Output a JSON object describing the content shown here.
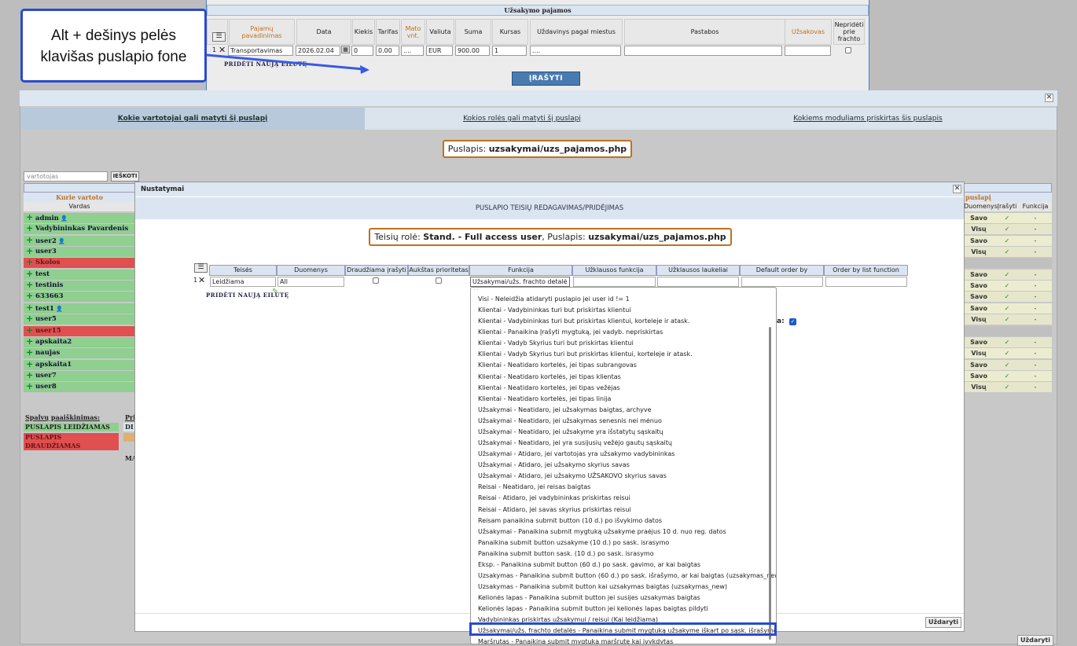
{
  "bg": {
    "title": "Užsakymo pajamos",
    "headers": [
      "Pajamų pavadinimas",
      "Data",
      "Kiekis",
      "Tarifas",
      "Mato vnt.",
      "Valiuta",
      "Suma",
      "Kursas",
      "Uždavinys pagal miestus",
      "Pastabos",
      "Užsakovas",
      "Nepridėti prie frachto"
    ],
    "row": {
      "num": "1",
      "name": "Transportavimas",
      "date": "2026.02.04",
      "qty": "0",
      "rate": "0.00",
      "unit": "....",
      "currency": "EUR",
      "sum": "900.00",
      "kursas": "1",
      "task": "....",
      "notes": "",
      "client": ""
    },
    "add_row": "PRIDĖTI NAUJĄ EILUTĘ",
    "save": "ĮRAŠYTI"
  },
  "callout": {
    "text": "Alt + dešinys pelės klavišas puslapio fone"
  },
  "dialog1": {
    "tabs": [
      "Kokie vartotojai gali matyti šį puslapį",
      "Kokios rolės gali matyti šį puslapį",
      "Kokiems moduliams priskirtas šis puslapis"
    ],
    "page_prefix": "Puslapis:",
    "page_name": "uzsakymai/uzs_pajamos.php",
    "search_placeholder": "vartotojas",
    "search_btn": "IEŠKOTI",
    "left_head_orange": "Kurie vartoto",
    "left_head": "Vardas",
    "users": [
      {
        "name": "admin",
        "cls": "g",
        "icon": true
      },
      {
        "name": "Vadybininkas Pavardenis",
        "cls": "g",
        "icon": false
      },
      {
        "name": "user2",
        "cls": "g",
        "icon": true
      },
      {
        "name": "user3",
        "cls": "g",
        "icon": false
      },
      {
        "name": "Skolos",
        "cls": "r",
        "icon": false
      },
      {
        "name": "test",
        "cls": "g",
        "icon": false
      },
      {
        "name": "testinis",
        "cls": "g",
        "icon": false
      },
      {
        "name": "633663",
        "cls": "g",
        "icon": false
      },
      {
        "name": "test1",
        "cls": "g",
        "icon": true
      },
      {
        "name": "user5",
        "cls": "g",
        "icon": false
      },
      {
        "name": "user15",
        "cls": "r",
        "icon": false
      },
      {
        "name": "apskaita2",
        "cls": "g",
        "icon": false
      },
      {
        "name": "naujas",
        "cls": "g",
        "icon": false
      },
      {
        "name": "apskaita1",
        "cls": "g",
        "icon": false
      },
      {
        "name": "user7",
        "cls": "g",
        "icon": false
      },
      {
        "name": "user8",
        "cls": "g",
        "icon": false
      }
    ],
    "right_head_orange": "puslapį",
    "right_heads": [
      "Duomenys",
      "Įrašyti",
      "Funkcija"
    ],
    "right_rows": [
      [
        "Savo",
        "✓",
        "-"
      ],
      [
        "Visų",
        "✓",
        "-"
      ],
      [
        "Savo",
        "✓",
        "-"
      ],
      [
        "Visų",
        "✓",
        "-"
      ],
      [
        "",
        "",
        ""
      ],
      [
        "Savo",
        "✓",
        "-"
      ],
      [
        "Savo",
        "✓",
        "-"
      ],
      [
        "Savo",
        "✓",
        "-"
      ],
      [
        "Savo",
        "✓",
        "-"
      ],
      [
        "Visų",
        "✓",
        "-"
      ],
      [
        "",
        "",
        ""
      ],
      [
        "Savo",
        "✓",
        "-"
      ],
      [
        "Visų",
        "✓",
        "-"
      ],
      [
        "Savo",
        "✓",
        "-"
      ],
      [
        "Savo",
        "✓",
        "-"
      ],
      [
        "Visų",
        "✓",
        "-"
      ]
    ],
    "legend_title": "Spalvų paaiškinimas:",
    "legend_allowed": "PUSLAPIS LEIDŽIAMAS",
    "legend_denied": "PUSLAPIS DRAUDŽIAMAS",
    "legend_pri": "Pri",
    "legend_di": "DI",
    "legend_ma": "MA",
    "close_btn": "Uždaryti"
  },
  "dialog2": {
    "title": "Nustatymai",
    "subtitle": "PUSLAPIO TEISIŲ REDAGAVIMAS/PRIDĖJIMAS",
    "role_prefix": "Teisių rolė:",
    "role_name": "Stand. - Full access user",
    "page_prefix": ", Puslapis:",
    "page_name": "uzsakymai/uzs_pajamos.php",
    "headers": [
      "Teisės",
      "Duomenys",
      "Draudžiama įrašyti",
      "Aukštas prioritetas",
      "Funkcija",
      "Užklausos funkcija",
      "Užklausos laukeliai",
      "Default order by",
      "Order by list function"
    ],
    "row": {
      "num": "1",
      "teises": "Leidžiama",
      "duomenys": "All",
      "funkcija": "Užsakymai/užs. frachto detalė"
    },
    "add_row": "PRIDĖTI NAUJĄ EILUTĘ",
    "side_label": "a:",
    "close_btn": "Uždaryti"
  },
  "dropdown": [
    "Visi - Neleidžia atidaryti puslapio jei user id != 1",
    "Klientai - Vadybininkas turi but priskirtas klientui",
    "Klientai - Vadybininkas turi but priskirtas klientui, korteleje ir atask.",
    "Klientai - Panaikina Įrašyti mygtuką, jei vadyb. nepriskirtas",
    "Klientai - Vadyb Skyrius turi but priskirtas klientui",
    "Klientai - Vadyb Skyrius turi but priskirtas klientui, korteleje ir atask.",
    "Klientai - Neatidaro kortelės, jei tipas subrangovas",
    "Klientai - Neatidaro kortelės, jei tipas klientas",
    "Klientai - Neatidaro kortelės, jei tipas vežėjas",
    "Klientai - Neatidaro kortelės, jei tipas linija",
    "Užsakymai - Neatidaro, jei užsakymas baigtas, archyve",
    "Užsakymai - Neatidaro, jei užsakymas senesnis nei mėnuo",
    "Užsakymai - Neatidaro, jei užsakyme yra išstatytų sąskaitų",
    "Užsakymai - Neatidaro, jei yra susijusių vežėjo gautų sąskaitų",
    "Užsakymai - Atidaro, jei vartotojas yra užsakymo vadybininkas",
    "Užsakymai - Atidaro, jei užsakymo skyrius savas",
    "Užsakymai - Atidaro, jei užsakymo UŽSAKOVO skyrius savas",
    "Reisai - Neatidaro, jei reisas baigtas",
    "Reisai - Atidaro, jei vadybininkas priskirtas reisui",
    "Reisai - Atidaro, jei savas skyrius priskirtas reisui",
    "Reisam panaikina submit button (10 d.) po išvykimo datos",
    "Užsakymai - Panaikina submit mygtuką užsakyme praėjus 10 d. nuo reg. datos",
    "Panaikina submit button uzsakyme (10 d.) po sask. israsymo",
    "Panaikina submit button sask. (10 d.) po sask. israsymo",
    "Eksp. - Panaikina submit button (60 d.) po sask. gavimo, ar kai baigtas",
    "Uzsakymas - Panaikina submit button (60 d.) po sask. išrašymo, ar kai baigtas (uzsakymas_new)",
    "Uzsakymas - Panaikina submit button kai uzsakymas baigtas (uzsakymas_new)",
    "Kelionės lapas - Panaikina submit button jei susijes uzsakymas baigtas",
    "Kelionės lapas - Panaikina submit button jei kelionės lapas baigtas pildyti",
    "Vadybininkas priskirtas užsakymui / reisui (Kai leidžiama)",
    "Užsakymai/užs. frachto detalės - Panaikina submit mygtuką užsakyme iškart po sąsk. išrašymo",
    "Maršrutas - Panaikina submit mygtuką maršrute kai įvykdytas"
  ]
}
